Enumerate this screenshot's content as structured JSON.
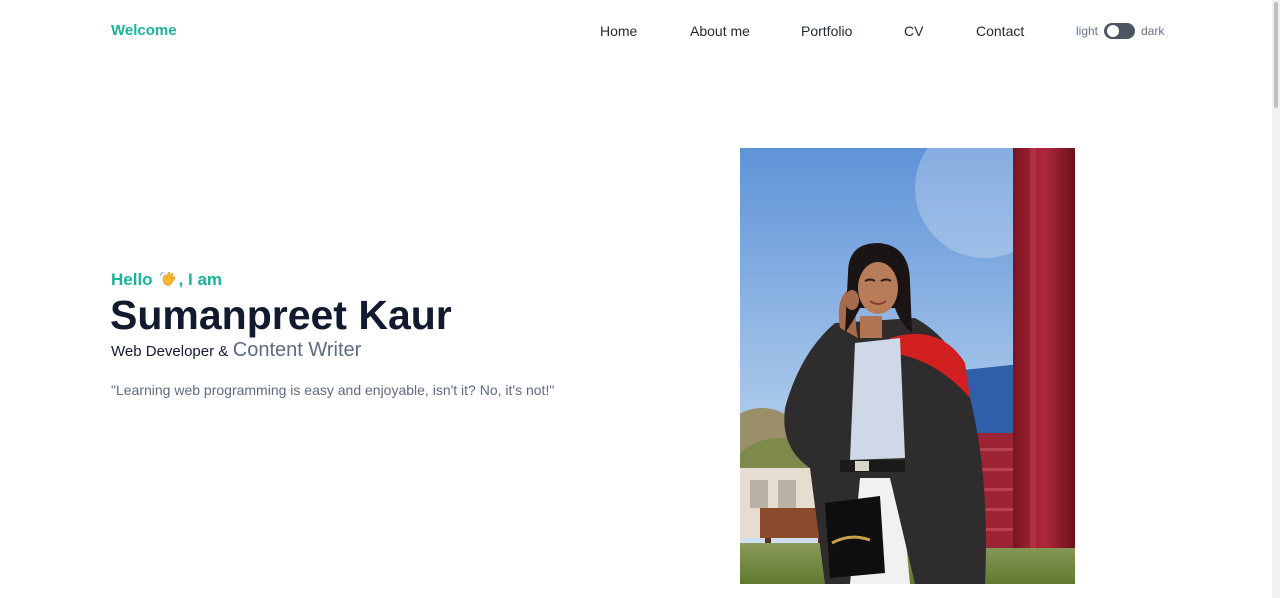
{
  "header": {
    "brand": "Welcome",
    "nav": [
      {
        "label": "Home"
      },
      {
        "label": "About me"
      },
      {
        "label": "Portfolio"
      },
      {
        "label": "CV"
      },
      {
        "label": "Contact"
      }
    ],
    "theme_toggle": {
      "light_label": "light",
      "dark_label": "dark",
      "state": "light"
    }
  },
  "hero": {
    "greeting_before": "Hello",
    "greeting_emoji": "waving-hand-icon",
    "greeting_after": ", I am",
    "name": "Sumanpreet Kaur",
    "role_static": "Web Developer &",
    "role_typed": "Content Writer",
    "quote": "\"Learning web programming is easy and enjoyable, isn't it? No, it's not!\""
  },
  "colors": {
    "accent": "#1bb39a",
    "heading": "#111a2e",
    "muted": "#5f6b7e",
    "toggle_track": "#4b5563"
  }
}
